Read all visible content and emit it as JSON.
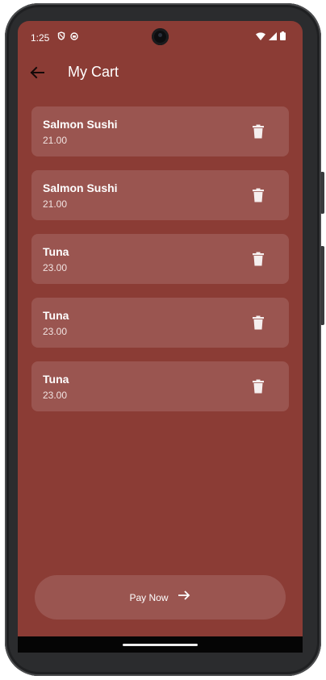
{
  "status_bar": {
    "time": "1:25",
    "icons": [
      "shield-icon",
      "sim-icon",
      "wifi-icon",
      "signal-icon",
      "battery-icon"
    ]
  },
  "app_bar": {
    "title": "My Cart",
    "back_icon": "arrow-left-icon"
  },
  "cart": {
    "items": [
      {
        "name": "Salmon Sushi",
        "price": "21.00"
      },
      {
        "name": "Salmon Sushi",
        "price": "21.00"
      },
      {
        "name": "Tuna",
        "price": "23.00"
      },
      {
        "name": "Tuna",
        "price": "23.00"
      },
      {
        "name": "Tuna",
        "price": "23.00"
      }
    ],
    "delete_icon": "trash-icon"
  },
  "pay_button": {
    "label": "Pay Now",
    "icon": "arrow-right-icon"
  },
  "colors": {
    "background": "#8b3c35",
    "card": "#9a5550",
    "text": "#ffffff"
  }
}
